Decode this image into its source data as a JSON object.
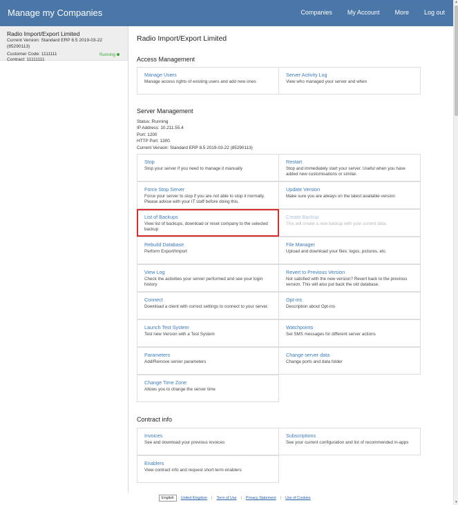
{
  "header": {
    "brand": "Manage my Companies",
    "nav": [
      "Companies",
      "My Account",
      "More",
      "Log out"
    ]
  },
  "sidebar": {
    "server_name": "Radio Import/Export Limited",
    "version_line": "Current Version: Standard ERP 8.5 2019-03-22 (85290113)",
    "customer_code": "Customer Code: 1111111",
    "contract": "Contract: 11111111",
    "status": "Running"
  },
  "main": {
    "title": "Radio Import/Export Limited",
    "access_title": "Access Management",
    "access_tiles": [
      {
        "title": "Manage Users",
        "desc": "Manage access rights of existing users and add new ones"
      },
      {
        "title": "Server Activity Log",
        "desc": "View who managed your server and when"
      }
    ],
    "server_title": "Server Management",
    "server_info": [
      "Status: Running",
      "IP Address: 10.211.55.4",
      "Port: 1200",
      "HTTP Port: 1300",
      "Current Version: Standard ERP 8.5 2019-03-22 (85290113)"
    ],
    "server_tiles": [
      {
        "title": "Stop",
        "desc": "Stop your server if you need to manage it manually"
      },
      {
        "title": "Restart",
        "desc": "Stop and immediately start your server. Useful when you have added new customisations or similar."
      },
      {
        "title": "Force Stop Server",
        "desc": "Force your server to stop if you are not able to stop it normally. Please advise with your IT staff before doing this."
      },
      {
        "title": "Update Version",
        "desc": "Make sure you are always on the latest available version"
      },
      {
        "title": "List of Backups",
        "desc": "View list of backups, download or reset company to the selected backup"
      },
      {
        "title": "Create Backup",
        "desc": "This will create a new backup with your current data."
      },
      {
        "title": "Rebuild Database",
        "desc": "Perform Export/Import"
      },
      {
        "title": "File Manager",
        "desc": "Upload and download your files: logos, pictures, etc."
      },
      {
        "title": "View Log",
        "desc": "Check the activities your server performed and see your login history"
      },
      {
        "title": "Revert to Previous Version",
        "desc": "Not satisfied with the new version? Revert back to the previous version. This will also put back the old database."
      },
      {
        "title": "Connect",
        "desc": "Download a client with correct settings to connect to your server."
      },
      {
        "title": "Opt-ins",
        "desc": "Description about Opt-ins"
      },
      {
        "title": "Launch Test System",
        "desc": "Test new Version with a Test System"
      },
      {
        "title": "Watchpoints",
        "desc": "Set SMS messages for different server actions"
      },
      {
        "title": "Parameters",
        "desc": "Add/Remove server parameters"
      },
      {
        "title": "Change server data",
        "desc": "Change ports and data folder"
      },
      {
        "title": "Change Time Zone",
        "desc": "Allows you to change the server time"
      }
    ],
    "contract_title": "Contract info",
    "contract_tiles": [
      {
        "title": "Invoices",
        "desc": "See and download your previous invoices"
      },
      {
        "title": "Subscriptions",
        "desc": "See your current configuration and list of recommended in-apps"
      },
      {
        "title": "Enablers",
        "desc": "View contract info and request short term enablers"
      }
    ]
  },
  "footer": {
    "language": "English",
    "links": [
      "United Kingdom",
      "Term of Use",
      "Privacy Statement",
      "Use of Cookies"
    ]
  }
}
